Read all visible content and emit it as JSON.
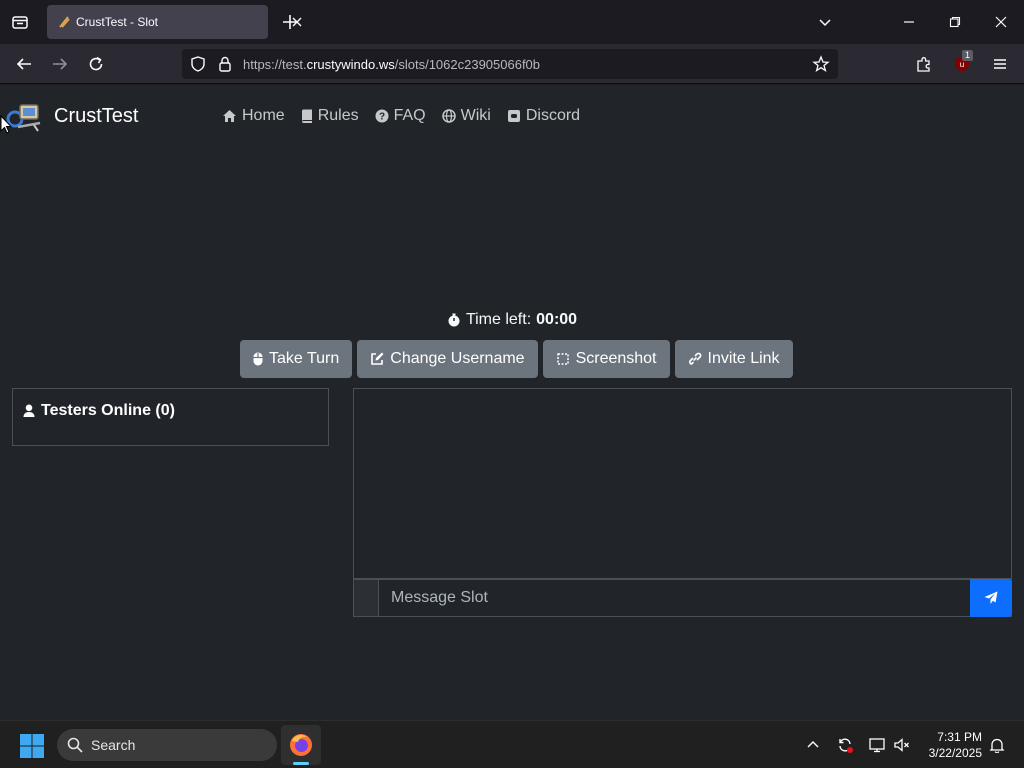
{
  "browser": {
    "tab_title": "CrustTest - Slot",
    "url_prefix": "https://test.",
    "url_domain": "crustywindo.ws",
    "url_path": "/slots/1062c23905066f0b",
    "extension_badge": "1"
  },
  "site": {
    "brand": "CrustTest",
    "nav": [
      {
        "label": "Home",
        "icon": "home-icon"
      },
      {
        "label": "Rules",
        "icon": "book-icon"
      },
      {
        "label": "FAQ",
        "icon": "question-circle-icon"
      },
      {
        "label": "Wiki",
        "icon": "globe-icon"
      },
      {
        "label": "Discord",
        "icon": "discord-icon"
      }
    ]
  },
  "slot": {
    "timer_label": "Time left:",
    "timer_value": "00:00",
    "actions": [
      {
        "label": "Take Turn",
        "icon": "mouse-icon"
      },
      {
        "label": "Change Username",
        "icon": "edit-icon"
      },
      {
        "label": "Screenshot",
        "icon": "screenshot-icon"
      },
      {
        "label": "Invite Link",
        "icon": "link-icon"
      }
    ],
    "testers_heading": "Testers Online (0)",
    "message_placeholder": "Message Slot"
  },
  "taskbar": {
    "search_placeholder": "Search",
    "time": "7:31 PM",
    "date": "3/22/2025"
  },
  "colors": {
    "page_bg": "#212529",
    "button_secondary": "#6c757d",
    "send_button": "#0d6efd",
    "chrome_bg": "#1c1b22"
  }
}
